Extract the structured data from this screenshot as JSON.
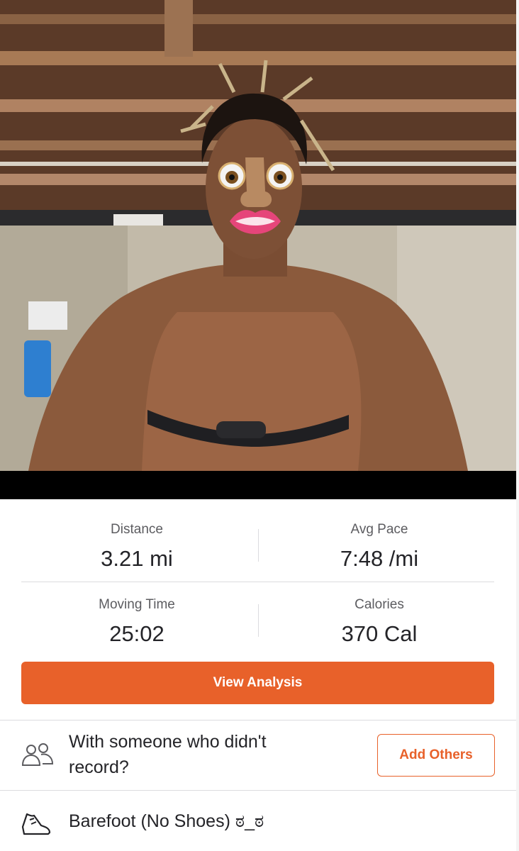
{
  "photo": {
    "alt_icon": "workout-photo"
  },
  "stats": {
    "distance": {
      "label": "Distance",
      "value": "3.21 mi"
    },
    "avg_pace": {
      "label": "Avg Pace",
      "value": "7:48 /mi"
    },
    "moving_time": {
      "label": "Moving Time",
      "value": "25:02"
    },
    "calories": {
      "label": "Calories",
      "value": "370 Cal"
    }
  },
  "actions": {
    "view_analysis": "View Analysis",
    "add_others": "Add Others"
  },
  "others": {
    "prompt": "With someone who didn't record?",
    "icon": "people-icon"
  },
  "gear": {
    "shoes": "Barefoot (No Shoes) ಠ_ಠ",
    "icon": "shoe-icon"
  },
  "colors": {
    "accent": "#e8612a",
    "text": "#242428",
    "muted": "#5c5c60"
  }
}
